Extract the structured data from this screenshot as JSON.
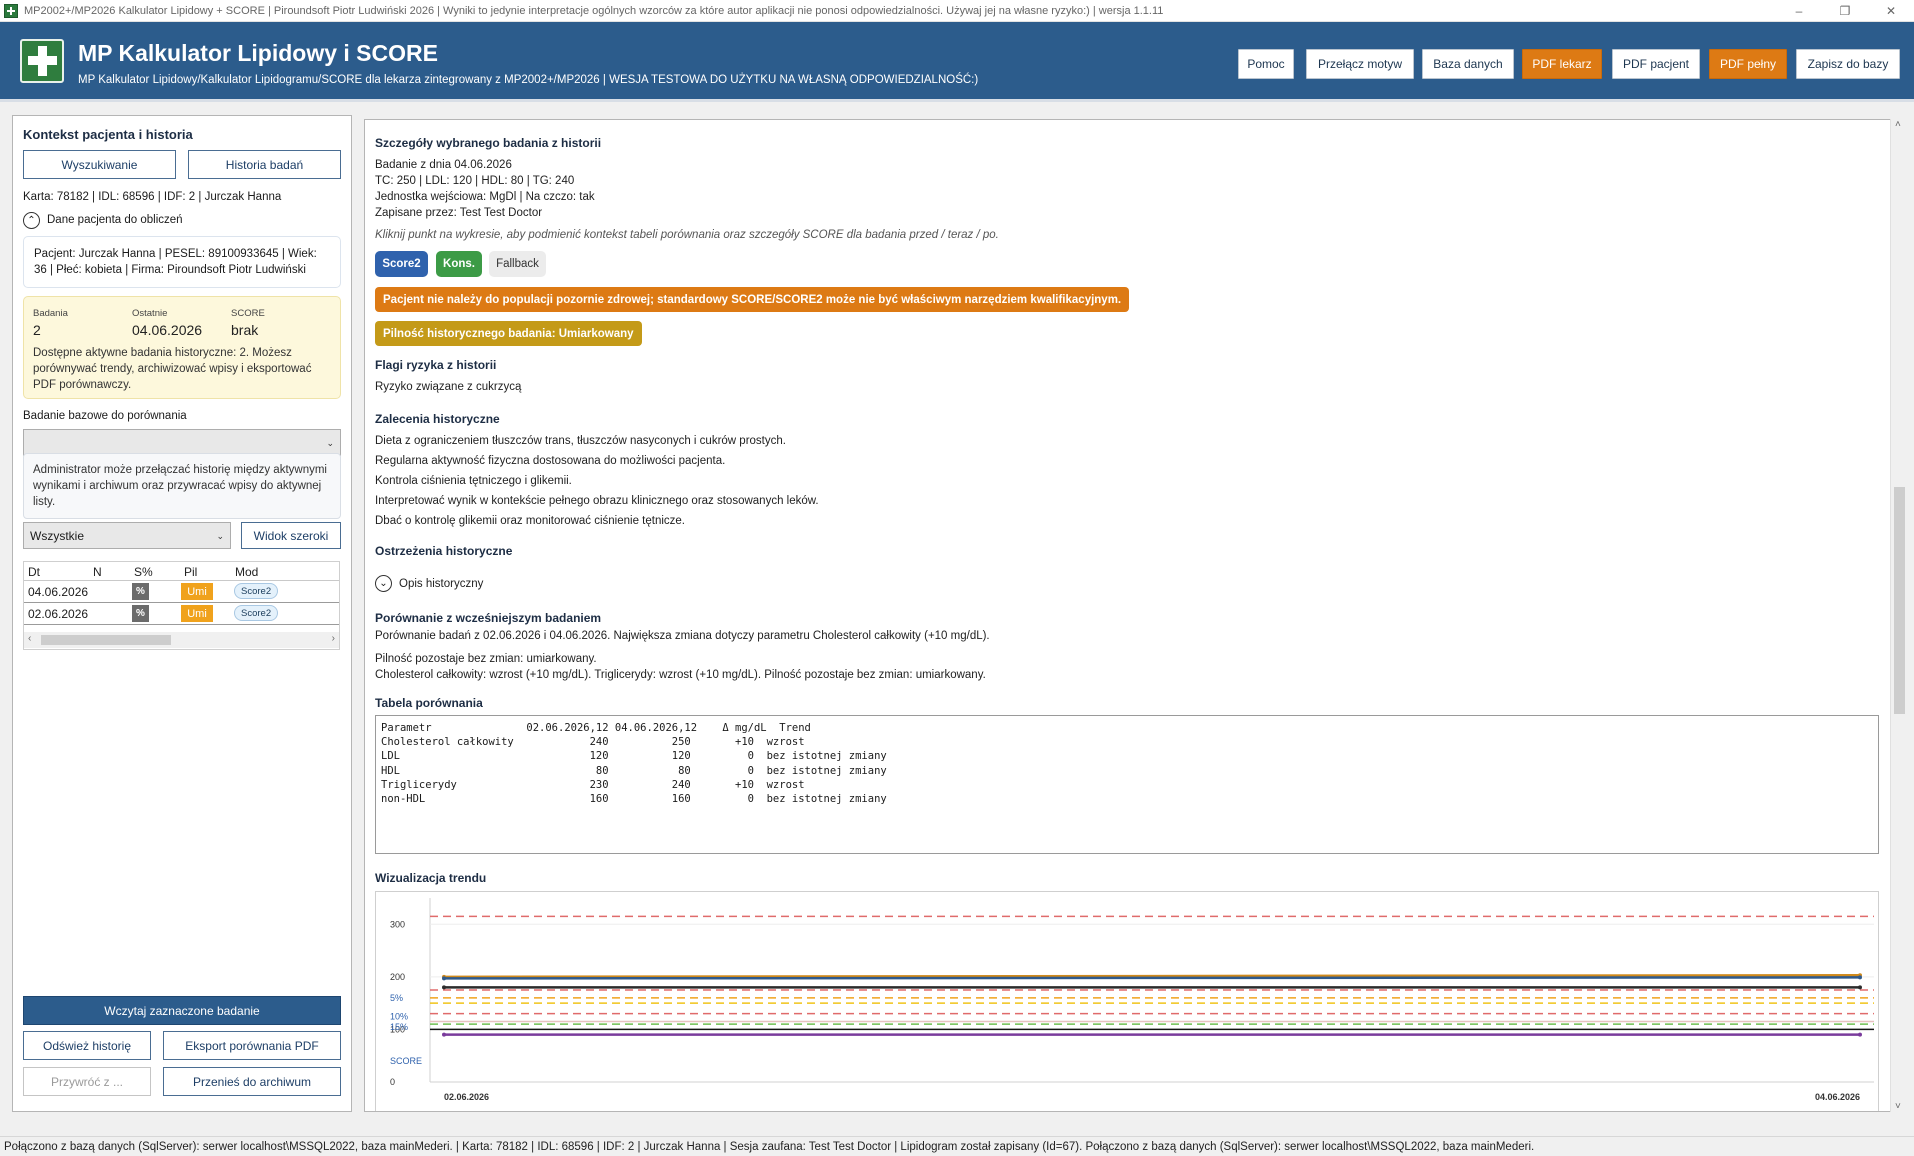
{
  "window": {
    "title": "MP2002+/MP2026 Kalkulator Lipidowy + SCORE | Piroundsoft Piotr Ludwiński 2026 | Wyniki to jedynie interpretacje ogólnych wzorców za które autor aplikacji nie ponosi odpowiedzialności. Używaj jej na własne ryzyko:) | wersja 1.1.11",
    "controls": [
      "–",
      "❐",
      "✕"
    ]
  },
  "header": {
    "title": "MP Kalkulator Lipidowy i SCORE",
    "subtitle": "MP Kalkulator Lipidowy/Kalkulator Lipidogramu/SCORE dla lekarza zintegrowany z MP2002+/MP2026 | WESJA TESTOWA DO UŻYTKU NA WŁASNĄ ODPOWIEDZIALNOŚĆ:)",
    "buttons": [
      "Pomoc",
      "Przełącz motyw",
      "Baza danych",
      "PDF lekarz",
      "PDF pacjent",
      "PDF pełny",
      "Zapisz do bazy"
    ],
    "accent_orange": "#dd7a14",
    "brand_blue": "#2c5c8c"
  },
  "left": {
    "title": "Kontekst pacjenta i historia",
    "search_button": "Wyszukiwanie",
    "history_button": "Historia badań",
    "card_line": "Karta: 78182 | IDL: 68596 | IDF: 2 | Jurczak Hanna",
    "section_toggle": "Dane pacjenta do obliczeń",
    "patient_line1": "Pacjent: Jurczak Hanna | PESEL: 89100933645 | Wiek:",
    "patient_line2": "36 | Płeć: kobieta | Firma: Piroundsoft  Piotr Ludwiński",
    "stats": {
      "badania_label": "Badania",
      "badania_value": "2",
      "ostatnie_label": "Ostatnie",
      "ostatnie_value": "04.06.2026",
      "score_label": "SCORE",
      "score_value": "brak",
      "desc": "Dostępne aktywne badania historyczne: 2. Możesz porównywać trendy, archiwizować wpisy i eksportować PDF porównawczy."
    },
    "baseline_label": "Badanie bazowe do porównania",
    "baseline_value": "",
    "admin_note": "Administrator może przełączać historię między aktywnymi wynikami i archiwum oraz przywracać wpisy do aktywnej listy.",
    "filter_value": "Wszystkie",
    "wide_view_button": "Widok szeroki",
    "grid": {
      "headers": [
        "Dt",
        "N",
        "S%",
        "Pil",
        "Mod"
      ],
      "rows": [
        {
          "date": "04.06.2026",
          "n": "",
          "s": "%",
          "pil": "Umi",
          "mod": "Score2"
        },
        {
          "date": "02.06.2026",
          "n": "",
          "s": "%",
          "pil": "Umi",
          "mod": "Score2"
        }
      ]
    },
    "load_button": "Wczytaj zaznaczone badanie",
    "refresh_button": "Odśwież historię",
    "export_button": "Eksport porównania PDF",
    "restore_button": "Przywróć z ...",
    "archive_button": "Przenieś do archiwum"
  },
  "detail": {
    "title": "Szczegóły wybranego badania z historii",
    "date_line": "Badanie z dnia 04.06.2026",
    "values_line": "TC: 250 | LDL: 120 | HDL: 80 | TG: 240",
    "unit_line": "Jednostka wejściowa: MgDl | Na czczo: tak",
    "saved_by_line": "Zapisane przez: Test Test Doctor",
    "hint": "Kliknij punkt na wykresie, aby podmienić kontekst tabeli porównania oraz szczegóły SCORE dla badania przed / teraz / po.",
    "chips": [
      "Score2",
      "Kons.",
      "Fallback"
    ],
    "warning_banner": "Pacjent nie należy do populacji pozornie zdrowej; standardowy SCORE/SCORE2 może nie być właściwym narzędziem kwalifikacyjnym.",
    "urgency_banner": "Pilność historycznego badania: Umiarkowany",
    "risk_flags_title": "Flagi ryzyka z historii",
    "risk_flags": [
      "Ryzyko związane z cukrzycą"
    ],
    "recommendations_title": "Zalecenia historyczne",
    "recommendations": [
      "Dieta z ograniczeniem tłuszczów trans, tłuszczów nasyconych i cukrów prostych.",
      "Regularna aktywność fizyczna dostosowana do możliwości pacjenta.",
      "Kontrola ciśnienia tętniczego i glikemii.",
      "Interpretować wynik w kontekście pełnego obrazu klinicznego oraz stosowanych leków.",
      "Dbać o kontrolę glikemii oraz monitorować ciśnienie tętnicze."
    ],
    "warnings_title": "Ostrzeżenia historyczne",
    "description_toggle": "Opis historyczny",
    "comparison_title": "Porównanie z wcześniejszym badaniem",
    "comparison_line": "Porównanie badań z 02.06.2026 i 04.06.2026. Największa zmiana dotyczy parametru Cholesterol całkowity (+10 mg/dL).",
    "comparison_note1": "Pilność pozostaje bez zmian: umiarkowany.",
    "comparison_note2": "Cholesterol całkowity: wzrost (+10 mg/dL). Triglicerydy: wzrost (+10 mg/dL). Pilność pozostaje bez zmian: umiarkowany.",
    "table_title": "Tabela porównania",
    "table_text": "Parametr               02.06.2026,12 04.06.2026,12    Δ mg/dL  Trend\nCholesterol całkowity            240          250       +10  wzrost\nLDL                              120          120         0  bez istotnej zmiany\nHDL                               80           80         0  bez istotnej zmiany\nTriglicerydy                     230          240       +10  wzrost\nnon-HDL                          160          160         0  bez istotnej zmiany",
    "chart_title": "Wizualizacja trendu"
  },
  "chart_data": {
    "type": "line",
    "title": "Wizualizacja trendu",
    "x": [
      "02.06.2026",
      "04.06.2026"
    ],
    "y_ticks": [
      "300",
      "200",
      "100",
      "0"
    ],
    "score_ticks": [
      "5%",
      "10%",
      "15%"
    ],
    "score_axis_label": "SCORE",
    "ylim": [
      0,
      350
    ],
    "grid": true,
    "series": [
      {
        "color": "#d08a1c",
        "values": [
          200,
          203
        ]
      },
      {
        "color": "#2f5a8c",
        "values": [
          197,
          199
        ]
      },
      {
        "color": "#2c2c2c",
        "values": [
          180,
          180
        ]
      },
      {
        "color": "#7a3b9c",
        "values": [
          90,
          90
        ]
      }
    ],
    "reference_lines": [
      {
        "y": 315,
        "color": "#e06b6b",
        "dash": true
      },
      {
        "y": 175,
        "color": "#e06b6b",
        "dash": true
      },
      {
        "y": 160,
        "color": "#f0a21c",
        "dash": true
      },
      {
        "y": 150,
        "color": "#f0c419",
        "dash": true
      },
      {
        "y": 130,
        "color": "#e06b6b",
        "dash": true
      },
      {
        "y": 115,
        "color": "#e8c2c2",
        "dash": false
      },
      {
        "y": 110,
        "color": "#6fbf52",
        "dash": true
      },
      {
        "y": 100,
        "color": "#111111",
        "dash": false
      }
    ]
  },
  "status": "Połączono z bazą danych (SqlServer): serwer localhost\\MSSQL2022, baza mainMederi. | Karta: 78182 | IDL: 68596 | IDF: 2 | Jurczak Hanna | Sesja zaufana: Test Test Doctor | Lipidogram został zapisany (Id=67). Połączono z bazą danych (SqlServer): serwer localhost\\MSSQL2022, baza mainMederi."
}
